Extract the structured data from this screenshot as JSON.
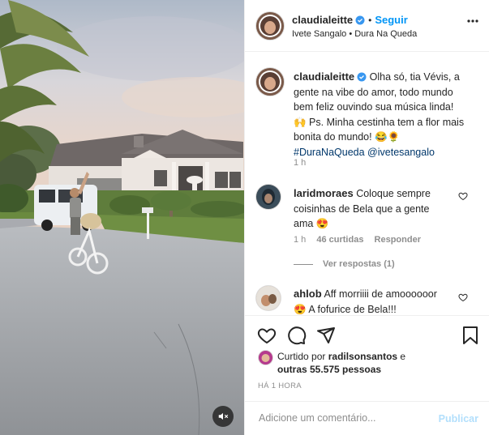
{
  "post": {
    "username": "claudialeitte",
    "follow_label": "Seguir",
    "separator": "•",
    "audio": "Ivete Sangalo • Dura Na Queda",
    "caption_username": "claudialeitte",
    "caption_line1": "Olha só, tia Vévis, a",
    "caption_line2": "gente na vibe do amor, todo mundo",
    "caption_line3": "bem feliz ouvindo sua música linda!",
    "caption_line4": "🙌 Ps. Minha cestinha tem a flor mais",
    "caption_line5": "bonita do mundo! 😂🌻",
    "caption_hashtag": "#DuraNaQueda",
    "caption_mention": "@ivetesangalo",
    "caption_age": "1 h"
  },
  "comments": [
    {
      "username": "laridmoraes",
      "text_line1": "Coloque sempre",
      "text_line2": "coisinhas de Bela que a gente",
      "text_line3": "ama 😍",
      "age": "1 h",
      "likes": "46 curtidas",
      "reply_label": "Responder",
      "view_replies": "Ver respostas (1)"
    },
    {
      "username": "ahlob",
      "text_line1": "Aff morriiii de amoooooor",
      "text_line2": "😍 A fofurice de Bela!!!"
    }
  ],
  "likes": {
    "prefix": "Curtido por",
    "user": "radilsonsantos",
    "conjunction": "e",
    "others": "outras 55.575 pessoas"
  },
  "timestamp": "HÁ 1 HORA",
  "add_comment": {
    "placeholder": "Adicione um comentário...",
    "publish_label": "Publicar"
  },
  "colors": {
    "accent": "#0095f6",
    "hashtag": "#00376b",
    "muted": "#8e8e8e",
    "publish_disabled": "#b2dffc"
  },
  "icons": [
    "verified-badge-icon",
    "more-options-icon",
    "heart-icon",
    "comment-icon",
    "share-icon",
    "bookmark-icon",
    "mute-icon",
    "emoji-icon"
  ]
}
